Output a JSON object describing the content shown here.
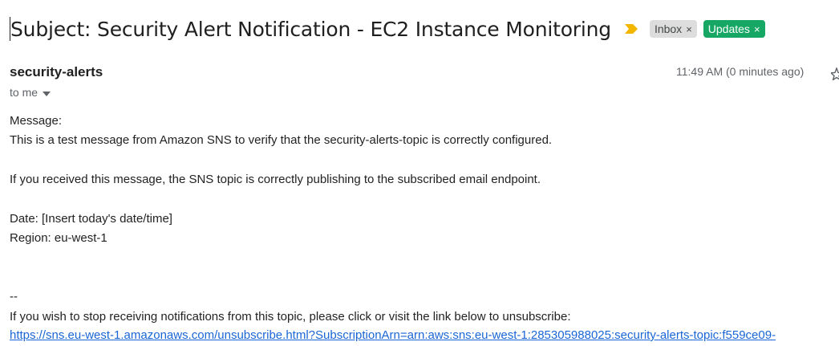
{
  "subject": {
    "text": "Subject: Security Alert Notification - EC2 Instance Monitoring",
    "importance_icon": "importance-marker-icon",
    "importance_color": "#f2b600"
  },
  "labels": [
    {
      "name": "Inbox",
      "close": "×",
      "bg": "#dddddd"
    },
    {
      "name": "Updates",
      "close": "×",
      "bg": "#16a765"
    }
  ],
  "header": {
    "sender": "security-alerts",
    "recipient": "to me",
    "timestamp": "11:49 AM (0 minutes ago)"
  },
  "body": {
    "message_label": "Message:",
    "line1": "This is a test message from Amazon SNS to verify that the security-alerts-topic is correctly configured.",
    "line2": "If you received this message, the SNS topic is correctly publishing to the subscribed email endpoint.",
    "date_line": "Date: [Insert today's date/time]",
    "region_line": "Region: eu-west-1",
    "separator": "--",
    "unsubscribe_text": "If you wish to stop receiving notifications from this topic, please click or visit the link below to unsubscribe:",
    "unsubscribe_link": "https://sns.eu-west-1.amazonaws.com/unsubscribe.html?SubscriptionArn=arn:aws:sns:eu-west-1:285305988025:security-alerts-topic:f559ce09-"
  }
}
